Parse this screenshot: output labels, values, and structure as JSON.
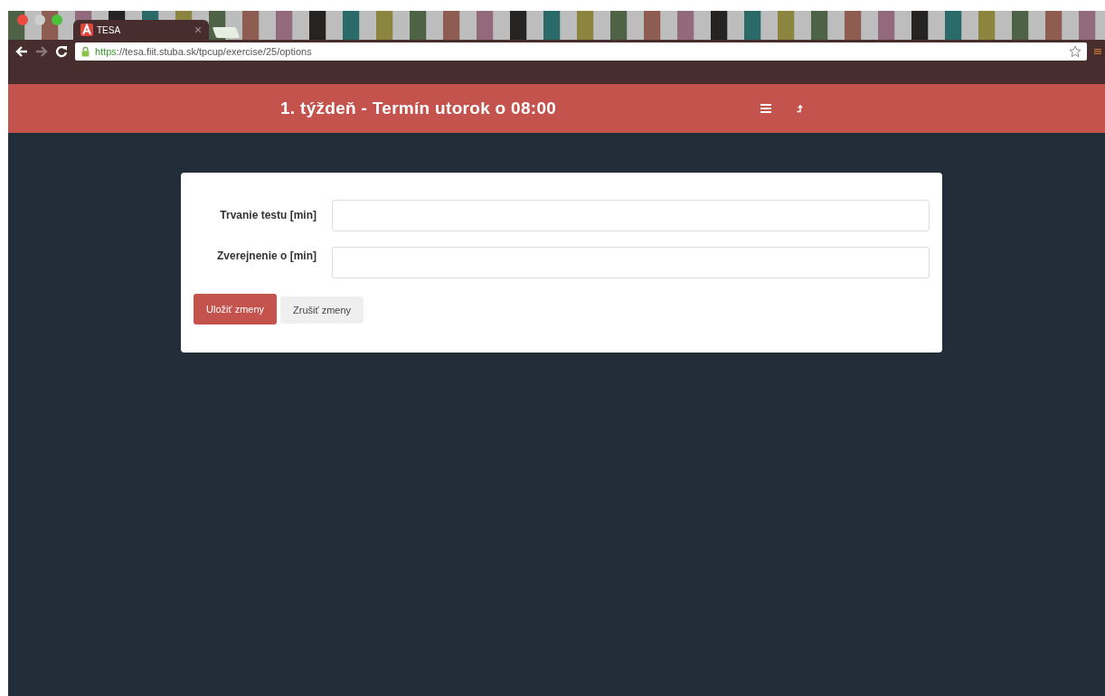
{
  "browser": {
    "tab": {
      "title": "TESA",
      "selected": true
    },
    "url": {
      "scheme": "https",
      "rest": "://tesa.fiit.stuba.sk/tpcup/exercise/25/options"
    }
  },
  "header": {
    "title": "1. týždeň - Termín utorok o 08:00"
  },
  "form": {
    "fields": [
      {
        "label": "Trvanie testu [min]"
      },
      {
        "label": "Zverejnenie o [min]"
      }
    ],
    "buttons": [
      {
        "label": "Uložiť zmeny",
        "kind": "primary"
      },
      {
        "label": "Zrušiť zmeny",
        "kind": "default"
      }
    ]
  }
}
